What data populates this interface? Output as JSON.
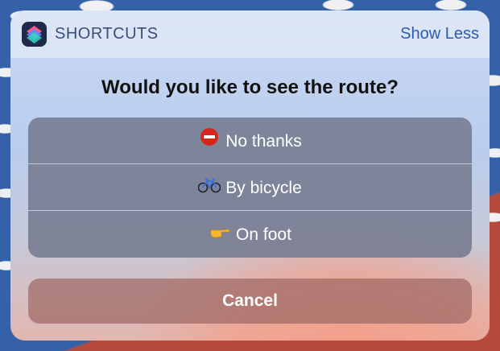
{
  "header": {
    "app_icon": "shortcuts-app-icon",
    "app_name": "SHORTCUTS",
    "show_less_label": "Show Less"
  },
  "prompt": {
    "question": "Would you like to see the route?"
  },
  "options": [
    {
      "icon": "no-entry-icon",
      "label": "No thanks"
    },
    {
      "icon": "bicycle-icon",
      "label": "By bicycle"
    },
    {
      "icon": "pointing-hand-icon",
      "label": "On foot"
    }
  ],
  "cancel_label": "Cancel",
  "colors": {
    "accent": "#2f59b0",
    "icon_red": "#d7261e"
  }
}
